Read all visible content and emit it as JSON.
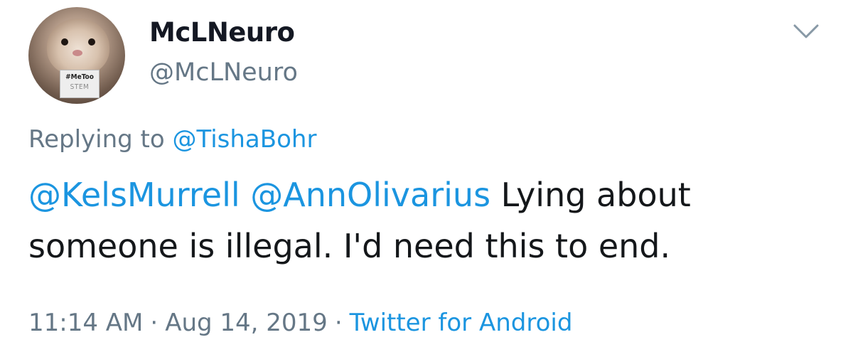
{
  "author": {
    "display_name": "McLNeuro",
    "handle": "@McLNeuro",
    "avatar_sign_line1": "#MeToo",
    "avatar_sign_line2": "STEM"
  },
  "reply": {
    "prefix": "Replying to",
    "to": "@TishaBohr"
  },
  "tweet": {
    "mention1": "@KelsMurrell",
    "mention2": "@AnnOlivarius",
    "text": "Lying about someone is illegal. I'd need this to end."
  },
  "meta": {
    "time": "11:14 AM",
    "separator": "·",
    "date": "Aug 14, 2019",
    "source": "Twitter for Android"
  },
  "colors": {
    "link": "#1b95e0",
    "secondary_text": "#657786",
    "primary_text": "#14171a"
  },
  "icons": {
    "menu": "chevron-down-icon"
  }
}
